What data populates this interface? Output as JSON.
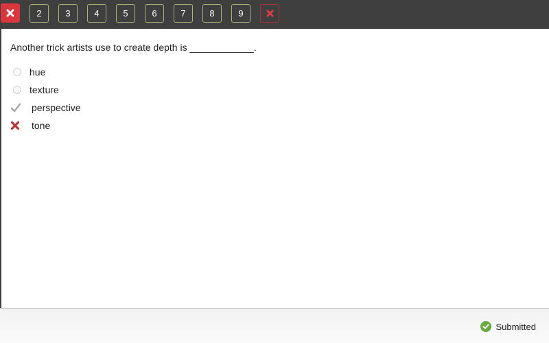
{
  "navigation": {
    "items": [
      {
        "label": "",
        "state": "current-incorrect",
        "icon": "close-icon"
      },
      {
        "label": "2",
        "state": "default"
      },
      {
        "label": "3",
        "state": "default"
      },
      {
        "label": "4",
        "state": "default"
      },
      {
        "label": "5",
        "state": "default"
      },
      {
        "label": "6",
        "state": "default"
      },
      {
        "label": "7",
        "state": "default"
      },
      {
        "label": "8",
        "state": "default"
      },
      {
        "label": "9",
        "state": "default"
      },
      {
        "label": "",
        "state": "incorrect",
        "icon": "close-icon"
      }
    ],
    "colors": {
      "bar": "#3f3f3f",
      "border": "#a6b57a",
      "current": "#d9363e",
      "incorrect": "#a7343a"
    }
  },
  "question": {
    "text": "Another trick artists use to create depth is ____________.",
    "options": [
      {
        "label": "hue",
        "state": "unselected",
        "icon": "radio-icon"
      },
      {
        "label": "texture",
        "state": "unselected",
        "icon": "radio-icon"
      },
      {
        "label": "perspective",
        "state": "correct-answer",
        "icon": "checkmark-icon"
      },
      {
        "label": "tone",
        "state": "selected-incorrect",
        "icon": "x-icon"
      }
    ]
  },
  "footer": {
    "status": "Submitted",
    "status_icon": "check-circle-icon",
    "status_color": "#6aa842"
  }
}
